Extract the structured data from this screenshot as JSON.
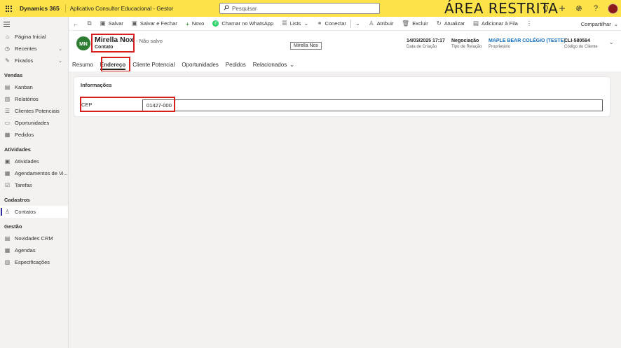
{
  "topbar": {
    "brand": "Dynamics 365",
    "app_name": "Aplicativo Consultor Educacional - Gestor",
    "search_placeholder": "Pesquisar",
    "banner": "ÁREA RESTRITA"
  },
  "sidebar": {
    "items_top": [
      {
        "label": "Página Inicial",
        "icon": "home-icon"
      },
      {
        "label": "Recentes",
        "icon": "clock-icon"
      },
      {
        "label": "Fixados",
        "icon": "pin-icon"
      }
    ],
    "sections": [
      {
        "title": "Vendas",
        "items": [
          "Kanban",
          "Relatórios",
          "Clientes Potenciais",
          "Oportunidades",
          "Pedidos"
        ]
      },
      {
        "title": "Atividades",
        "items": [
          "Atividades",
          "Agendamentos de Vi...",
          "Tarefas"
        ]
      },
      {
        "title": "Cadastros",
        "items": [
          "Contatos"
        ]
      },
      {
        "title": "Gestão",
        "items": [
          "Novidades CRM",
          "Agendas",
          "Especificações"
        ]
      }
    ]
  },
  "commands": {
    "save": "Salvar",
    "save_close": "Salvar e Fechar",
    "new": "Novo",
    "whatsapp": "Chamar no WhatsApp",
    "lists": "Lists",
    "connect": "Conectar",
    "assign": "Atribuir",
    "delete": "Excluir",
    "refresh": "Atualizar",
    "add_queue": "Adicionar à Fila",
    "share": "Compartilhar"
  },
  "record": {
    "initials": "MN",
    "name": "Mirella Nox",
    "type": "Contato",
    "status": "- Não salvo",
    "tooltip": "Mirella Nox",
    "fields": [
      {
        "value": "14/03/2025 17:17",
        "label": "Data de Criação"
      },
      {
        "value": "Negociação",
        "label": "Tipo de Relação"
      },
      {
        "value": "MAPLE BEAR COLÉGIO (TESTE)",
        "label": "Proprietário"
      },
      {
        "value": "CLI-580594",
        "label": "Código do Cliente"
      }
    ]
  },
  "tabs": [
    "Resumo",
    "Endereço",
    "Cliente Potencial",
    "Oportunidades",
    "Pedidos",
    "Relacionados"
  ],
  "selected_tab": "Endereço",
  "form": {
    "section_title": "Informações",
    "cep_label": "CEP",
    "cep_value": "01427-000"
  },
  "colors": {
    "topbar": "#fde24a",
    "highlight": "#d61f1f",
    "avatar": "#2e7d32",
    "link": "#0f6cbd"
  }
}
